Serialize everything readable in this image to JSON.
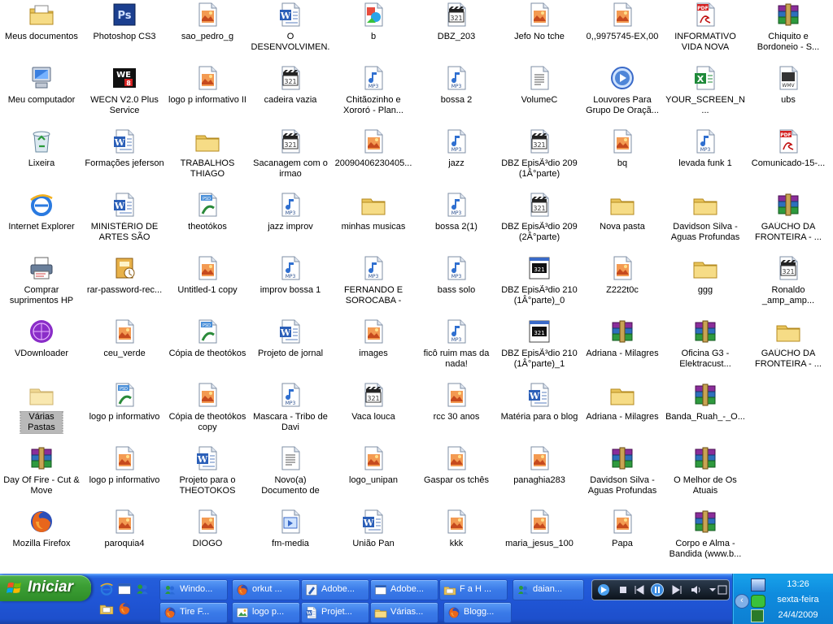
{
  "desktop": {
    "icons": [
      {
        "label": "Meus documentos",
        "icon": "my-documents"
      },
      {
        "label": "Meu computador",
        "icon": "my-computer"
      },
      {
        "label": "Lixeira",
        "icon": "recycle-bin"
      },
      {
        "label": "Internet Explorer",
        "icon": "internet-explorer"
      },
      {
        "label": "Comprar suprimentos HP",
        "icon": "printer"
      },
      {
        "label": "VDownloader",
        "icon": "vdownloader"
      },
      {
        "label": "Várias Pastas",
        "icon": "folder"
      },
      {
        "label": "Day Of Fire - Cut & Move",
        "icon": "winrar"
      },
      {
        "label": "Mozilla Firefox",
        "icon": "firefox"
      },
      {
        "label": "Photoshop CS3",
        "icon": "photoshop"
      },
      {
        "label": "WECN V2.0 Plus Service",
        "icon": "wecn"
      },
      {
        "label": "Formações jeferson",
        "icon": "word"
      },
      {
        "label": "MINISTÉRIO DE ARTES SÃO BENTO",
        "icon": "word"
      },
      {
        "label": "rar-password-rec...",
        "icon": "installer"
      },
      {
        "label": "ceu_verde",
        "icon": "image"
      },
      {
        "label": "logo p informativo",
        "icon": "psd"
      },
      {
        "label": "logo p informativo",
        "icon": "image"
      },
      {
        "label": "paroquia4",
        "icon": "image"
      },
      {
        "label": "sao_pedro_g",
        "icon": "image"
      },
      {
        "label": "logo p informativo II",
        "icon": "image"
      },
      {
        "label": "TRABALHOS THIAGO",
        "icon": "folder"
      },
      {
        "label": "theotókos",
        "icon": "psd"
      },
      {
        "label": "Untitled-1 copy",
        "icon": "image"
      },
      {
        "label": "Cópia de theotókos",
        "icon": "psd"
      },
      {
        "label": "Cópia de theotókos copy",
        "icon": "image"
      },
      {
        "label": "Projeto para o THEOTOKOS",
        "icon": "word"
      },
      {
        "label": "DIOGO",
        "icon": "image"
      },
      {
        "label": "O DESENVOLVIMEN...",
        "icon": "word"
      },
      {
        "label": "cadeira vazia",
        "icon": "clapper"
      },
      {
        "label": "Sacanagem com o irmao",
        "icon": "clapper"
      },
      {
        "label": "jazz improv",
        "icon": "mp3"
      },
      {
        "label": "improv bossa 1",
        "icon": "mp3"
      },
      {
        "label": "Projeto de jornal",
        "icon": "word"
      },
      {
        "label": "Mascara - Tribo de Davi",
        "icon": "mp3"
      },
      {
        "label": "Novo(a) Documento de texto",
        "icon": "text"
      },
      {
        "label": "fm-media",
        "icon": "media"
      },
      {
        "label": "b",
        "icon": "bitmap"
      },
      {
        "label": "Chitãozinho e Xororó - Plan...",
        "icon": "mp3"
      },
      {
        "label": "20090406230405...",
        "icon": "image"
      },
      {
        "label": "minhas musicas",
        "icon": "folder"
      },
      {
        "label": "FERNANDO E SOROCABA - PAG...",
        "icon": "mp3"
      },
      {
        "label": "images",
        "icon": "image"
      },
      {
        "label": "Vaca louca",
        "icon": "clapper"
      },
      {
        "label": "logo_unipan",
        "icon": "image"
      },
      {
        "label": "União Pan",
        "icon": "word"
      },
      {
        "label": "DBZ_203",
        "icon": "clapper"
      },
      {
        "label": "bossa 2",
        "icon": "mp3"
      },
      {
        "label": "jazz",
        "icon": "mp3"
      },
      {
        "label": "bossa 2(1)",
        "icon": "mp3"
      },
      {
        "label": "bass solo",
        "icon": "mp3"
      },
      {
        "label": "ficô ruim mas da nada!",
        "icon": "mp3"
      },
      {
        "label": "rcc 30 anos",
        "icon": "image"
      },
      {
        "label": "Gaspar os tchês",
        "icon": "image"
      },
      {
        "label": "kkk",
        "icon": "image"
      },
      {
        "label": "Jefo No tche",
        "icon": "image"
      },
      {
        "label": "VolumeC",
        "icon": "text"
      },
      {
        "label": "DBZ EpisÃ³dio 209 (1Â°parte)",
        "icon": "clapper"
      },
      {
        "label": "DBZ EpisÃ³dio 209 (2Â°parte)",
        "icon": "clapper"
      },
      {
        "label": "DBZ EpisÃ³dio 210 (1Â°parte)_0",
        "icon": "video-window"
      },
      {
        "label": "DBZ EpisÃ³dio 210 (1Â°parte)_1",
        "icon": "video-window"
      },
      {
        "label": "Matéria para o blog",
        "icon": "word"
      },
      {
        "label": "panaghia283",
        "icon": "image"
      },
      {
        "label": "maria_jesus_100",
        "icon": "image"
      },
      {
        "label": "0,,9975745-EX,00",
        "icon": "image"
      },
      {
        "label": "Louvores Para Grupo De Oraçã...",
        "icon": "playlist"
      },
      {
        "label": "bq",
        "icon": "image"
      },
      {
        "label": "Nova pasta",
        "icon": "folder"
      },
      {
        "label": "Z222t0c",
        "icon": "image"
      },
      {
        "label": "Adriana - Milagres",
        "icon": "winrar"
      },
      {
        "label": "Adriana - Milagres",
        "icon": "folder"
      },
      {
        "label": "Davidson Silva - Aguas Profundas",
        "icon": "winrar"
      },
      {
        "label": "Papa",
        "icon": "image"
      },
      {
        "label": "INFORMATIVO VIDA NOVA",
        "icon": "pdf"
      },
      {
        "label": "YOUR_SCREEN_N...",
        "icon": "excel"
      },
      {
        "label": "levada funk 1",
        "icon": "mp3"
      },
      {
        "label": "Davidson Silva - Aguas Profundas",
        "icon": "folder"
      },
      {
        "label": "ggg",
        "icon": "folder"
      },
      {
        "label": "Oficina G3 - Elektracust...",
        "icon": "winrar"
      },
      {
        "label": "Banda_Ruah_-_O...",
        "icon": "winrar"
      },
      {
        "label": "O Melhor de Os Atuais",
        "icon": "winrar"
      },
      {
        "label": "Corpo e Alma - Bandida (www.b...",
        "icon": "winrar"
      },
      {
        "label": "Chiquito e Bordoneio - S...",
        "icon": "winrar"
      },
      {
        "label": "ubs",
        "icon": "wmv"
      },
      {
        "label": "Comunicado-15-...",
        "icon": "pdf"
      },
      {
        "label": "GAÚCHO DA FRONTEIRA - ...",
        "icon": "winrar"
      },
      {
        "label": "Ronaldo _amp_amp...",
        "icon": "clapper"
      },
      {
        "label": "GAÚCHO DA FRONTEIRA - ...",
        "icon": "folder"
      }
    ]
  },
  "taskbar": {
    "start_label": "Iniciar",
    "quick_launch": [
      "internet-explorer-icon",
      "outlook-icon",
      "messenger-icon",
      "show-desktop-icon",
      "firefox-icon"
    ],
    "buttons": [
      {
        "label": "Windo...",
        "icon": "messenger"
      },
      {
        "label": "orkut ...",
        "icon": "firefox"
      },
      {
        "label": "Adobe...",
        "icon": "adobe-pen"
      },
      {
        "label": "Adobe...",
        "icon": "adobe-window"
      },
      {
        "label": "F a H ...",
        "icon": "folder-apps"
      },
      {
        "label": "daian...",
        "icon": "messenger"
      },
      {
        "label": "Tire F...",
        "icon": "firefox"
      },
      {
        "label": "logo p...",
        "icon": "image-editor"
      },
      {
        "label": "Projet...",
        "icon": "word"
      },
      {
        "label": "Várias...",
        "icon": "folder"
      },
      {
        "label": "Blogg...",
        "icon": "firefox"
      }
    ],
    "media_player": {
      "label": "windows-media-player-toolbar"
    },
    "clock": {
      "time": "13:26",
      "day": "sexta-feira",
      "date": "24/4/2009"
    },
    "colors": {
      "start_green": "#3c9f35",
      "taskbar_blue": "#245edb",
      "tray_blue": "#0f8cde"
    }
  }
}
